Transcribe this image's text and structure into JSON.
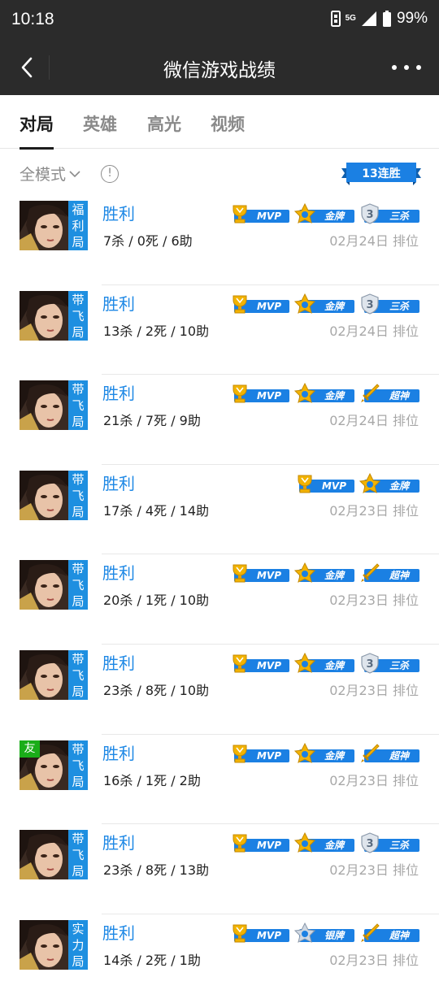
{
  "status_bar": {
    "time": "10:18",
    "network": "5G",
    "battery": "99%"
  },
  "nav": {
    "title": "微信游戏战绩"
  },
  "tabs": [
    {
      "label": "对局",
      "active": true
    },
    {
      "label": "英雄",
      "active": false
    },
    {
      "label": "高光",
      "active": false
    },
    {
      "label": "视频",
      "active": false
    }
  ],
  "filter": {
    "mode_label": "全模式",
    "streak": "13连胜"
  },
  "colors": {
    "accent": "#1e88e5",
    "badge_blue": "#1b80e3",
    "mode_tag": "#1e8fe0",
    "friend_tag": "#1aad19",
    "gold": "#f2b300"
  },
  "matches": [
    {
      "mode": "福利局",
      "friend": "",
      "result": "胜利",
      "stats": "7杀 / 0死 / 6助",
      "date": "02月24日 排位",
      "badges": [
        {
          "type": "mvp",
          "label": "MVP"
        },
        {
          "type": "gold",
          "label": "金牌"
        },
        {
          "type": "triple",
          "label": "三杀"
        }
      ]
    },
    {
      "mode": "带飞局",
      "friend": "",
      "result": "胜利",
      "stats": "13杀 / 2死 / 10助",
      "date": "02月24日 排位",
      "badges": [
        {
          "type": "mvp",
          "label": "MVP"
        },
        {
          "type": "gold",
          "label": "金牌"
        },
        {
          "type": "triple",
          "label": "三杀"
        }
      ]
    },
    {
      "mode": "带飞局",
      "friend": "",
      "result": "胜利",
      "stats": "21杀 / 7死 / 9助",
      "date": "02月24日 排位",
      "badges": [
        {
          "type": "mvp",
          "label": "MVP"
        },
        {
          "type": "gold",
          "label": "金牌"
        },
        {
          "type": "legend",
          "label": "超神"
        }
      ]
    },
    {
      "mode": "带飞局",
      "friend": "",
      "result": "胜利",
      "stats": "17杀 / 4死 / 14助",
      "date": "02月23日 排位",
      "badges": [
        {
          "type": "mvp",
          "label": "MVP"
        },
        {
          "type": "gold",
          "label": "金牌"
        }
      ]
    },
    {
      "mode": "带飞局",
      "friend": "",
      "result": "胜利",
      "stats": "20杀 / 1死 / 10助",
      "date": "02月23日 排位",
      "badges": [
        {
          "type": "mvp",
          "label": "MVP"
        },
        {
          "type": "gold",
          "label": "金牌"
        },
        {
          "type": "legend",
          "label": "超神"
        }
      ]
    },
    {
      "mode": "带飞局",
      "friend": "",
      "result": "胜利",
      "stats": "23杀 / 8死 / 10助",
      "date": "02月23日 排位",
      "badges": [
        {
          "type": "mvp",
          "label": "MVP"
        },
        {
          "type": "gold",
          "label": "金牌"
        },
        {
          "type": "triple",
          "label": "三杀"
        }
      ]
    },
    {
      "mode": "带飞局",
      "friend": "友",
      "result": "胜利",
      "stats": "16杀 / 1死 / 2助",
      "date": "02月23日 排位",
      "badges": [
        {
          "type": "mvp",
          "label": "MVP"
        },
        {
          "type": "gold",
          "label": "金牌"
        },
        {
          "type": "legend",
          "label": "超神"
        }
      ]
    },
    {
      "mode": "带飞局",
      "friend": "",
      "result": "胜利",
      "stats": "23杀 / 8死 / 13助",
      "date": "02月23日 排位",
      "badges": [
        {
          "type": "mvp",
          "label": "MVP"
        },
        {
          "type": "gold",
          "label": "金牌"
        },
        {
          "type": "triple",
          "label": "三杀"
        }
      ]
    },
    {
      "mode": "实力局",
      "friend": "",
      "result": "胜利",
      "stats": "14杀 / 2死 / 1助",
      "date": "02月23日 排位",
      "badges": [
        {
          "type": "mvp",
          "label": "MVP"
        },
        {
          "type": "silver",
          "label": "银牌"
        },
        {
          "type": "legend",
          "label": "超神"
        }
      ]
    }
  ]
}
